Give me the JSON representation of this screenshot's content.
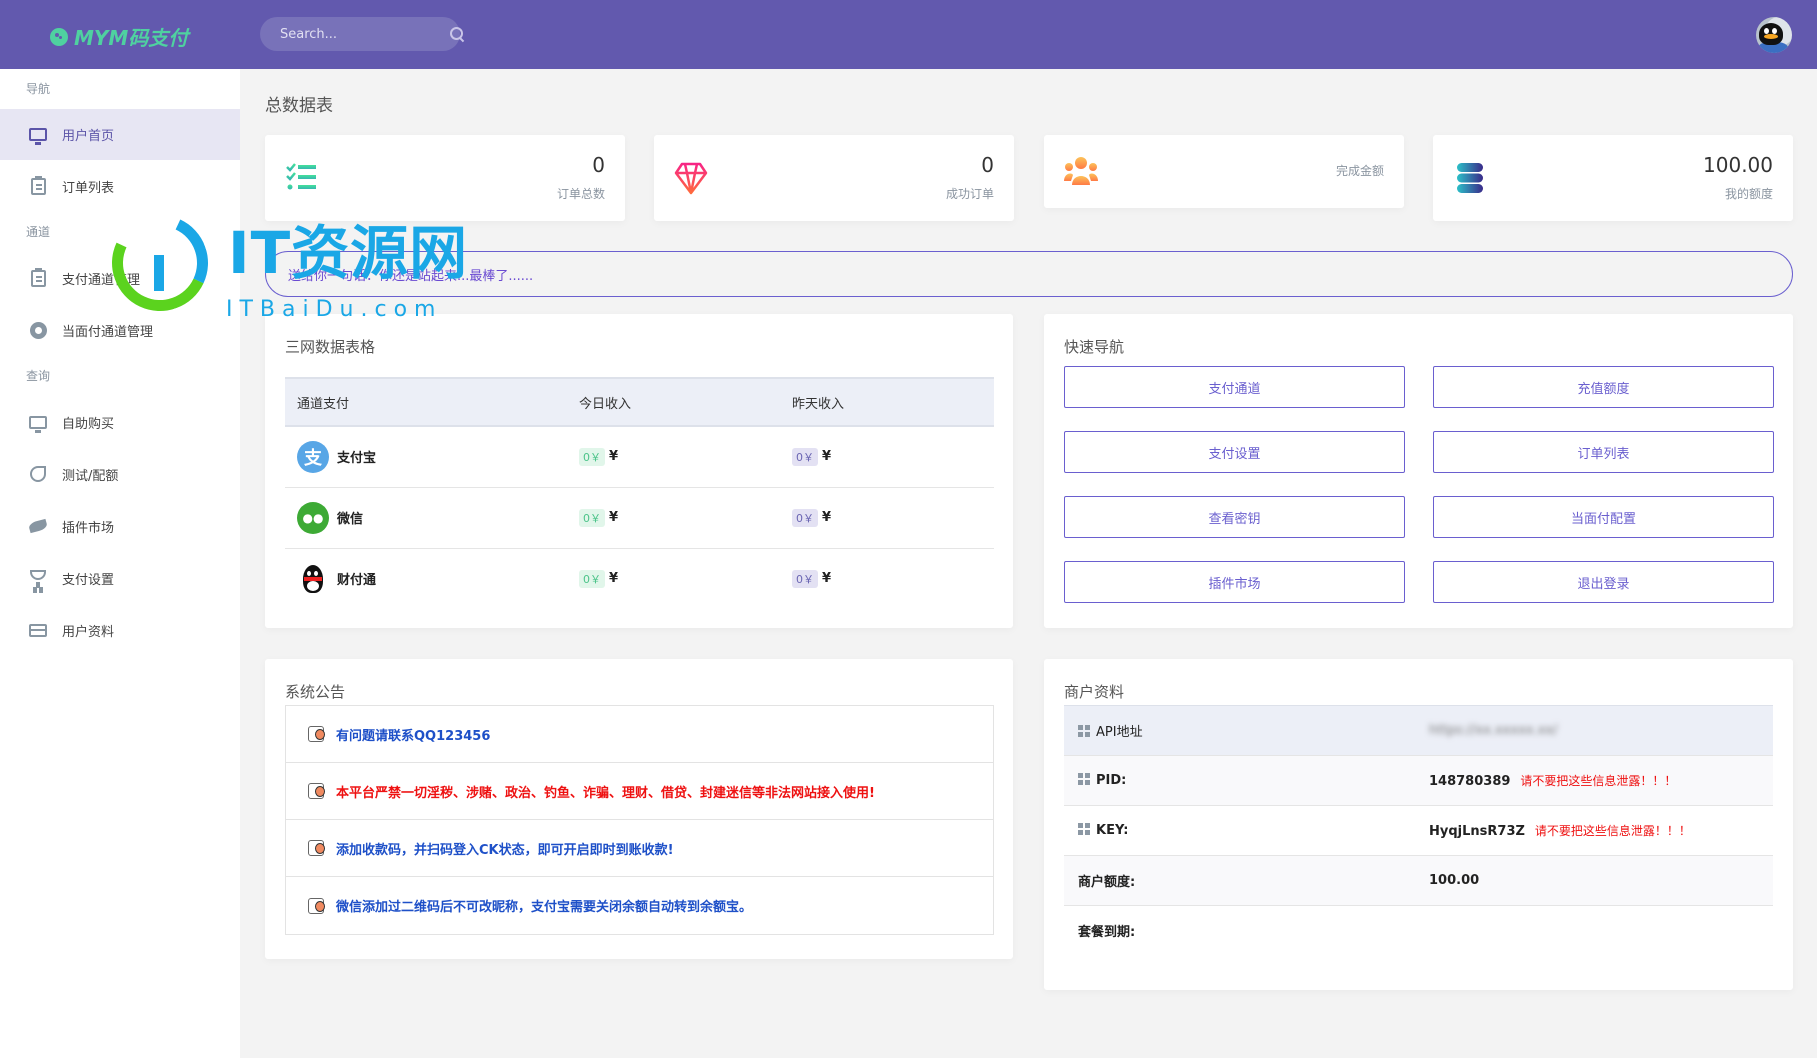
{
  "app": {
    "logo_text": "MYM码支付",
    "search_placeholder": "Search..."
  },
  "sidebar": {
    "sections": [
      {
        "title": "导航",
        "items": [
          {
            "label": "用户首页",
            "icon": "monitor-icon",
            "active": true
          },
          {
            "label": "订单列表",
            "icon": "clipboard-icon"
          }
        ]
      },
      {
        "title": "通道",
        "items": [
          {
            "label": "支付通道管理",
            "icon": "clipboard-icon"
          },
          {
            "label": "当面付通道管理",
            "icon": "lifebuoy-icon"
          }
        ]
      },
      {
        "title": "查询",
        "items": [
          {
            "label": "自助购买",
            "icon": "monitor-icon"
          },
          {
            "label": "测试/配额",
            "icon": "pie-chart-icon"
          },
          {
            "label": "插件市场",
            "icon": "leaf-icon"
          },
          {
            "label": "支付设置",
            "icon": "trophy-icon"
          },
          {
            "label": "用户资料",
            "icon": "credit-card-icon"
          }
        ]
      }
    ]
  },
  "main": {
    "page_title": "总数据表",
    "stats": [
      {
        "value": "0",
        "label": "订单总数",
        "icon": "checklist-icon",
        "color": "#3fcf9a"
      },
      {
        "value": "0",
        "label": "成功订单",
        "icon": "diamond-icon",
        "color": "#f0306e"
      },
      {
        "value": "",
        "label": "完成金额",
        "icon": "users-icon",
        "color": "#fb8a4a"
      },
      {
        "value": "100.00",
        "label": "我的额度",
        "icon": "database-icon",
        "color": "#2bb6c4"
      }
    ],
    "banner_text": "送给你一句话：你还是站起来...最棒了......",
    "channels": {
      "title": "三网数据表格",
      "columns": [
        "通道支付",
        "今日收入",
        "昨天收入"
      ],
      "rows": [
        {
          "name": "支付宝",
          "icon": "alipay-icon",
          "today": "0￥",
          "yesterday": "0￥",
          "unit": "¥"
        },
        {
          "name": "微信",
          "icon": "wechat-icon",
          "today": "0￥",
          "yesterday": "0￥",
          "unit": "¥"
        },
        {
          "name": "财付通",
          "icon": "qq-penguin-icon",
          "today": "0￥",
          "yesterday": "0￥",
          "unit": "¥"
        }
      ]
    },
    "quick_nav": {
      "title": "快速导航",
      "buttons": [
        "支付通道",
        "充值额度",
        "支付设置",
        "订单列表",
        "查看密钥",
        "当面付配置",
        "插件市场",
        "退出登录"
      ]
    },
    "notices": {
      "title": "系统公告",
      "items": [
        {
          "text": "有问题请联系QQ123456",
          "color": "blue"
        },
        {
          "text": "本平台严禁一切淫秽、涉赌、政治、钓鱼、诈骗、理财、借贷、封建迷信等非法网站接入使用!",
          "color": "red"
        },
        {
          "text": "添加收款码，并扫码登入CK状态，即可开启即时到账收款!",
          "color": "blue"
        },
        {
          "text": "微信添加过二维码后不可改昵称，支付宝需要关闭余额自动转到余额宝。",
          "color": "blue"
        }
      ]
    },
    "merchant": {
      "title": "商户资料",
      "rows": [
        {
          "key": "API地址",
          "value": "https://xx.xxxxx.xx/",
          "blurred": true,
          "warn": ""
        },
        {
          "key": "PID:",
          "value": "148780389",
          "warn": "请不要把这些信息泄露！！！"
        },
        {
          "key": "KEY:",
          "value": "HyqjLnsR73Z",
          "warn": "请不要把这些信息泄露！！！"
        },
        {
          "key": "商户额度:",
          "value": "100.00",
          "warn": ""
        },
        {
          "key": "套餐到期:",
          "value": "",
          "warn": ""
        }
      ]
    }
  },
  "watermark": {
    "title": "IT资源网",
    "subtitle": "ITBaiDu.com"
  }
}
